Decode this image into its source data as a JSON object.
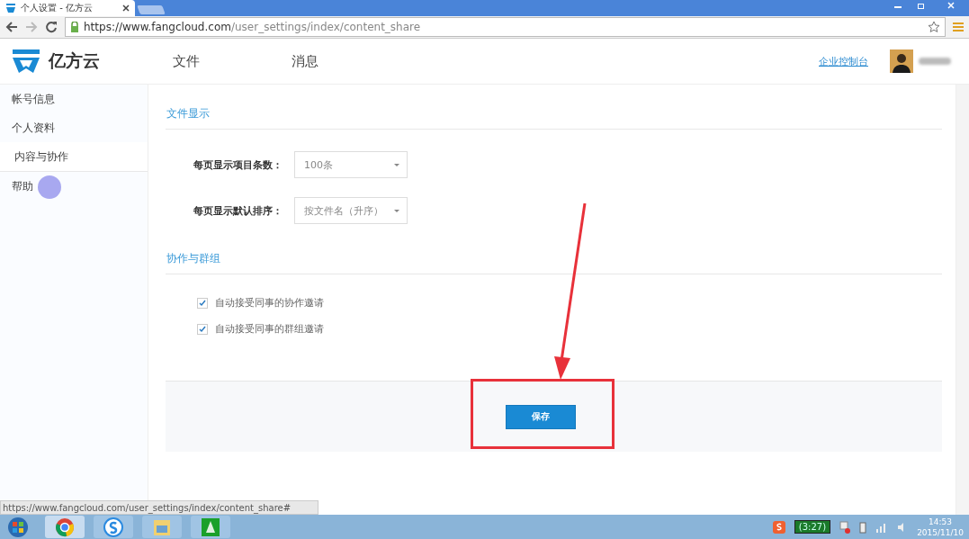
{
  "browser": {
    "tab_title": "个人设置 - 亿方云",
    "url_host": "https://www.fangcloud.com",
    "url_path": "/user_settings/index/content_share"
  },
  "header": {
    "logo_text": "亿方云",
    "nav": [
      {
        "label": "文件",
        "selected": false
      },
      {
        "label": "消息",
        "selected": false
      }
    ],
    "admin_link": "企业控制台"
  },
  "sidebar": {
    "items": [
      {
        "label": "帐号信息",
        "selected": false
      },
      {
        "label": "个人资料",
        "selected": false
      },
      {
        "label": "内容与协作",
        "selected": true
      },
      {
        "label": "帮助",
        "selected": false
      }
    ]
  },
  "sections": [
    {
      "title": "文件显示",
      "fields": [
        {
          "label": "每页显示项目条数：",
          "value": "100条"
        },
        {
          "label": "每页显示默认排序：",
          "value": "按文件名（升序）"
        }
      ]
    },
    {
      "title": "协作与群组",
      "checkboxes": [
        {
          "label": "自动接受同事的协作邀请",
          "checked": true
        },
        {
          "label": "自动接受同事的群组邀请",
          "checked": true
        }
      ]
    }
  ],
  "save_button": "保存",
  "status_url": "https://www.fangcloud.com/user_settings/index/content_share#",
  "taskbar": {
    "battery": "(3:27)",
    "time": "14:53",
    "date": "2015/11/10"
  }
}
